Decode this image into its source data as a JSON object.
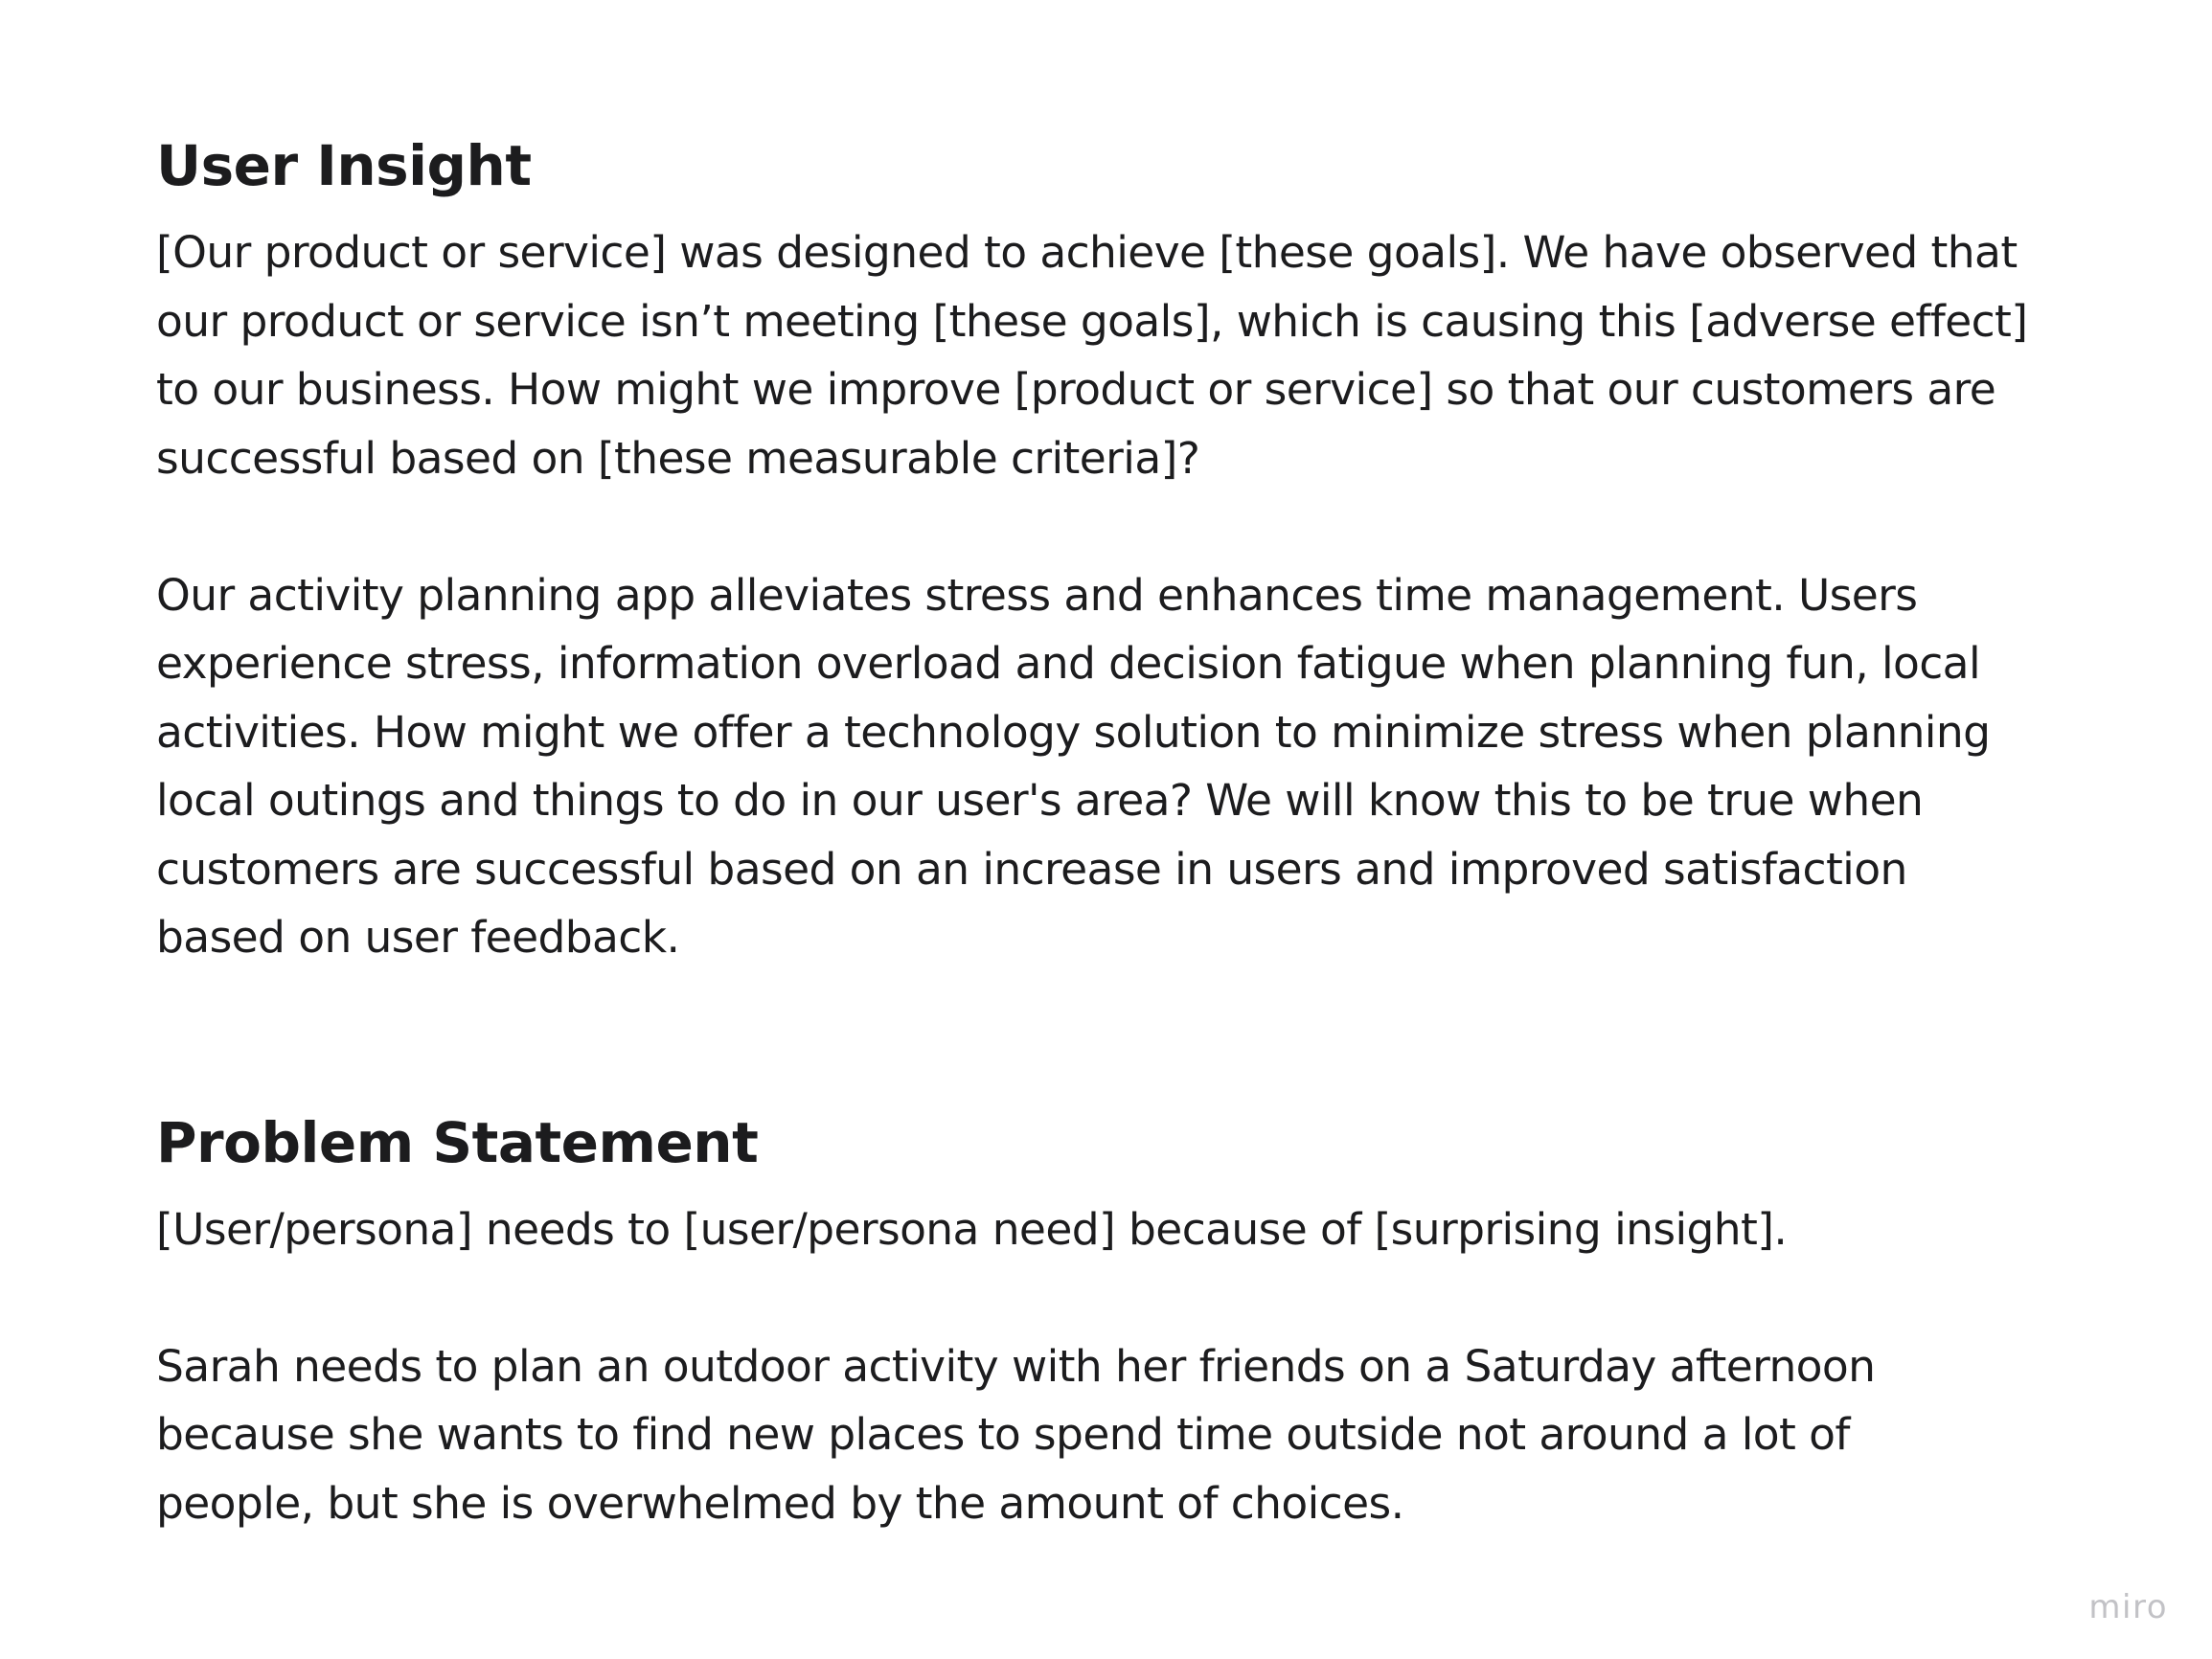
{
  "sections": [
    {
      "title": "User Insight",
      "template": "[Our product or service] was designed to achieve [these goals]. We have observed that\nour product or service isn’t meeting [these goals], which is causing this [adverse effect]\nto our business. How might we improve [product or service] so that our customers are\nsuccessful based on [these measurable criteria]?",
      "answer": "Our activity planning app alleviates stress and enhances time management. Users\nexperience stress, information overload and decision fatigue when planning fun, local\nactivities. How might we offer a technology solution to minimize stress when planning\nlocal outings and things to do in our user's area? We will know this to be true when\ncustomers are successful based on an increase in users and improved satisfaction\nbased on user feedback."
    },
    {
      "title": "Problem Statement",
      "template": "[User/persona] needs to [user/persona need] because of [surprising insight].",
      "answer": "Sarah needs to plan an outdoor activity with her friends on a Saturday afternoon\nbecause she wants to find new places to spend time outside not around a lot of\npeople, but she is overwhelmed by the amount of choices."
    }
  ],
  "watermark": "miro"
}
